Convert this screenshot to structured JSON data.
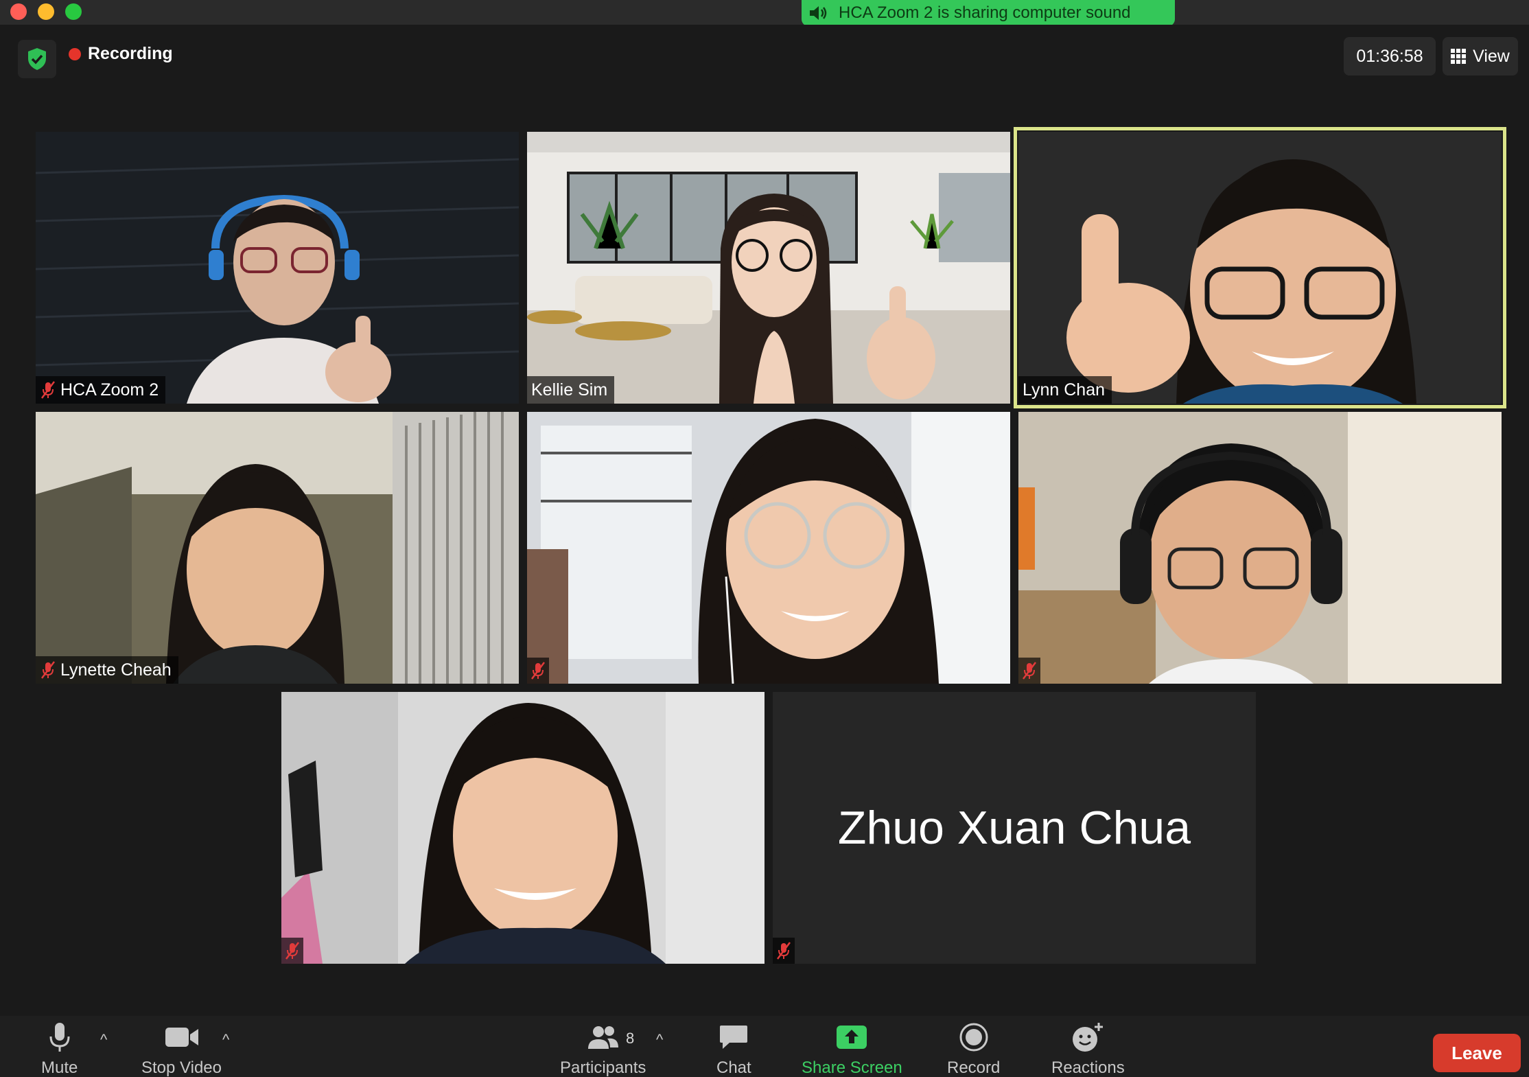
{
  "window": {
    "share_banner": "HCA Zoom 2 is sharing computer sound"
  },
  "topbar": {
    "recording_label": "Recording",
    "timer": "01:36:58",
    "view_label": "View"
  },
  "participants": [
    {
      "name": "HCA Zoom 2",
      "muted": true,
      "active_speaker": false,
      "video": true
    },
    {
      "name": "Kellie Sim",
      "muted": false,
      "active_speaker": false,
      "video": true
    },
    {
      "name": "Lynn Chan",
      "muted": false,
      "active_speaker": true,
      "video": true
    },
    {
      "name": "Lynette Cheah",
      "muted": true,
      "active_speaker": false,
      "video": true
    },
    {
      "name": "",
      "muted": true,
      "active_speaker": false,
      "video": true
    },
    {
      "name": "",
      "muted": true,
      "active_speaker": false,
      "video": true
    },
    {
      "name": "",
      "muted": true,
      "active_speaker": false,
      "video": true
    },
    {
      "name": "Zhuo Xuan Chua",
      "muted": true,
      "active_speaker": false,
      "video": false
    }
  ],
  "toolbar": {
    "mute": "Mute",
    "stop_video": "Stop Video",
    "participants": "Participants",
    "participants_count": "8",
    "chat": "Chat",
    "share_screen": "Share Screen",
    "record": "Record",
    "reactions": "Reactions",
    "leave": "Leave",
    "share_color": "#3ccf63",
    "leave_color": "#d73b2c"
  }
}
